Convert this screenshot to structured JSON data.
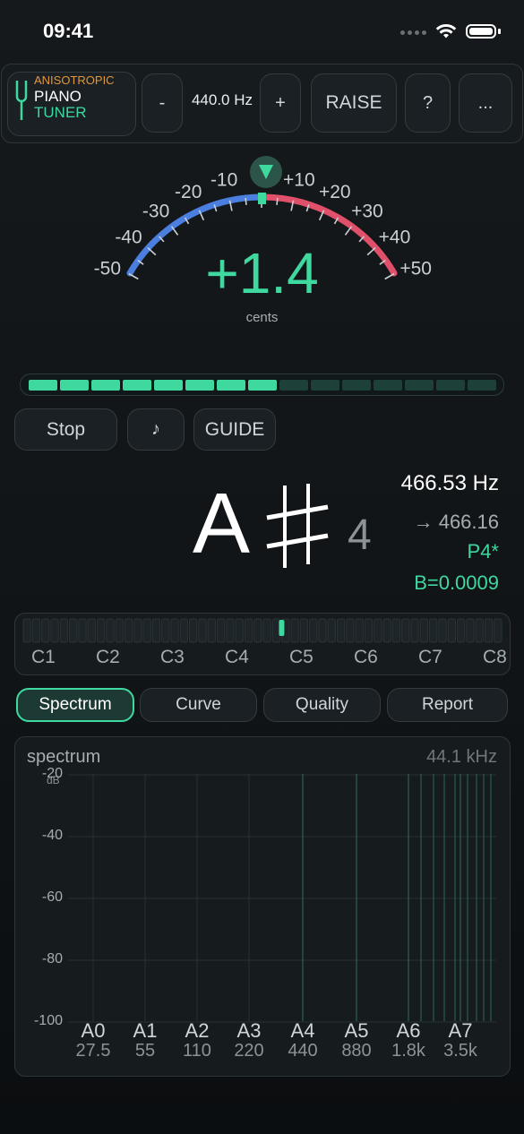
{
  "status_bar": {
    "time": "09:41"
  },
  "header": {
    "brand_line1": "ANISOTROPIC",
    "brand_line2": "PIANO",
    "brand_line3": "TUNER",
    "minus_label": "-",
    "pitch_reference": "440.0 Hz",
    "plus_label": "+",
    "raise_label": "RAISE",
    "help_label": "?",
    "more_label": "..."
  },
  "meter": {
    "cents": 1.4,
    "cents_display": "+1.4",
    "unit": "cents",
    "scale_labels": [
      "-50",
      "-40",
      "-30",
      "-20",
      "-10",
      "+10",
      "+20",
      "+30",
      "+40",
      "+50"
    ],
    "colors": {
      "flat": "#4a7fe0",
      "sharp": "#e0506a",
      "accent": "#3fd9a0"
    }
  },
  "level_meter": {
    "segments_total": 15,
    "segments_lit": 8
  },
  "controls": {
    "stop_label": "Stop",
    "note_icon": "♪",
    "guide_label": "GUIDE"
  },
  "note": {
    "letter": "A",
    "accidental": "♯",
    "octave": "4",
    "frequency": "466.53 Hz",
    "target": "→ 466.16",
    "interval": "P4*",
    "inharmonicity": "B=0.0009"
  },
  "keyboard": {
    "octave_labels": [
      "C1",
      "C2",
      "C3",
      "C4",
      "C5",
      "C6",
      "C7",
      "C8"
    ],
    "current_key_fraction": 0.54
  },
  "tabs": [
    {
      "label": "Spectrum",
      "active": true
    },
    {
      "label": "Curve",
      "active": false
    },
    {
      "label": "Quality",
      "active": false
    },
    {
      "label": "Report",
      "active": false
    }
  ],
  "spectrum": {
    "title": "spectrum",
    "sample_rate": "44.1 kHz",
    "y_unit": "dB",
    "y_ticks": [
      "-20",
      "-40",
      "-60",
      "-80",
      "-100"
    ],
    "x_notes": [
      "A0",
      "A1",
      "A2",
      "A3",
      "A4",
      "A5",
      "A6",
      "A7"
    ],
    "x_freqs": [
      "27.5",
      "55",
      "110",
      "220",
      "440",
      "880",
      "1.8k",
      "3.5k"
    ]
  }
}
